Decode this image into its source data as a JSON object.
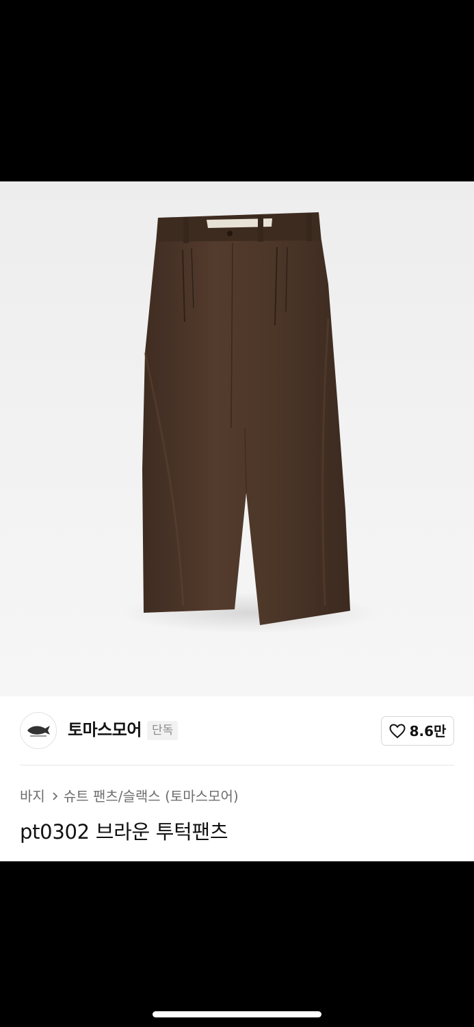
{
  "product": {
    "image_icon": "brown-two-tuck-pants-photo",
    "brand": {
      "logo_icon": "whale-logo-icon",
      "name": "토마스모어",
      "badge": "단독"
    },
    "likes": {
      "icon": "heart-outline-icon",
      "count": "8.6만"
    },
    "breadcrumb": {
      "category": "바지",
      "separator_icon": "chevron-right-icon",
      "subcategory": "슈트 팬츠/슬랙스 (토마스모어)"
    },
    "title": "pt0302 브라운 투턱팬츠"
  },
  "colors": {
    "pants": "#4a3427",
    "background": "#f0f0f0",
    "text_primary": "#111111",
    "text_secondary": "#6d6d6d"
  }
}
